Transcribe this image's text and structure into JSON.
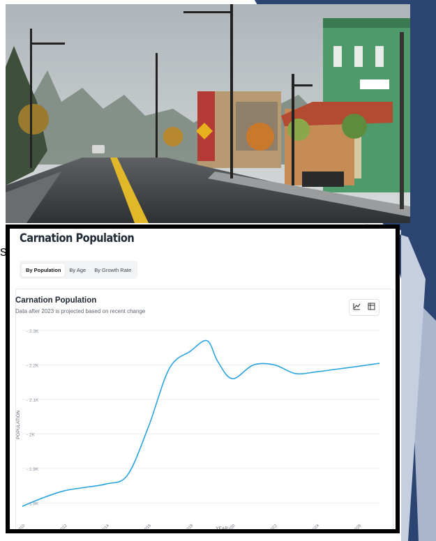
{
  "stray_text": "s",
  "page_title": "Carnation Population",
  "tabs": [
    {
      "label": "By Population",
      "active": true
    },
    {
      "label": "By Age",
      "active": false
    },
    {
      "label": "By Growth Rate",
      "active": false
    }
  ],
  "chart_title": "Carnation Population",
  "chart_subtitle": "Data after 2023 is projected based on recent change",
  "view_icons": [
    "line-chart-icon",
    "table-icon"
  ],
  "chart_data": {
    "type": "line",
    "title": "Carnation Population",
    "subtitle": "Data after 2023 is projected based on recent change",
    "xlabel": "YEAR",
    "ylabel": "POPULATION",
    "xlim": [
      2010,
      2027
    ],
    "ylim": [
      1.75,
      2.3
    ],
    "x_ticks": [
      2010,
      2012,
      2014,
      2016,
      2018,
      2020,
      2022,
      2024,
      2026,
      2028
    ],
    "y_ticks": [
      "1.8K",
      "1.9K",
      "2K",
      "2.1K",
      "2.2K",
      "2.3K"
    ],
    "y_tick_values": [
      1.8,
      1.9,
      2.0,
      2.1,
      2.2,
      2.3
    ],
    "grid": true,
    "series": [
      {
        "color": "#29a3e0",
        "x": [
          2010,
          2011,
          2012,
          2013,
          2014,
          2015,
          2016,
          2017,
          2018,
          2018.8,
          2019.3,
          2020,
          2021,
          2022,
          2023,
          2024,
          2025,
          2026,
          2027
        ],
        "y": [
          1.79,
          1.815,
          1.835,
          1.845,
          1.855,
          1.88,
          2.02,
          2.19,
          2.24,
          2.27,
          2.21,
          2.16,
          2.2,
          2.2,
          2.175,
          2.18,
          2.188,
          2.196,
          2.205
        ]
      }
    ]
  }
}
